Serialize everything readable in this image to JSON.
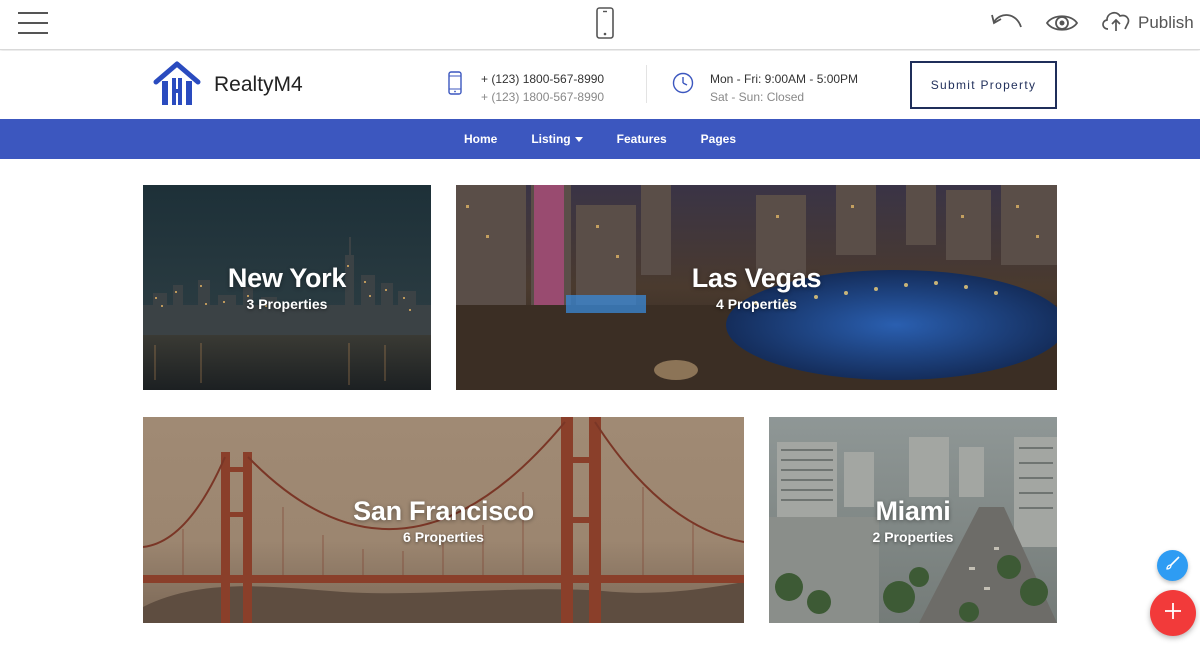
{
  "editor": {
    "menu_icon": "hamburger-icon",
    "device_icon": "mobile-phone-icon",
    "undo_icon": "undo-icon",
    "preview_icon": "eye-icon",
    "publish_icon": "cloud-upload-icon",
    "publish_label": "Publish"
  },
  "header": {
    "brand": "RealtyM4",
    "phone_primary": "+ (123) 1800-567-8990",
    "phone_secondary": "+ (123) 1800-567-8990",
    "hours_weekday": "Mon - Fri: 9:00AM - 5:00PM",
    "hours_weekend": "Sat - Sun: Closed",
    "submit_label": "Submit Property"
  },
  "nav": {
    "items": [
      {
        "label": "Home"
      },
      {
        "label": "Listing",
        "dropdown": true
      },
      {
        "label": "Features"
      },
      {
        "label": "Pages"
      }
    ]
  },
  "cities": [
    {
      "name": "New York",
      "count": "3 Properties"
    },
    {
      "name": "Las Vegas",
      "count": "4 Properties"
    },
    {
      "name": "San Francisco",
      "count": "6 Properties"
    },
    {
      "name": "Miami",
      "count": "2 Properties"
    }
  ],
  "colors": {
    "nav_bg": "#3c57bf",
    "brand_blue": "#2a4bbf",
    "submit_border": "#1f2e5a",
    "fab_add": "#f23a3a",
    "fab_brush": "#2e9cf3"
  }
}
